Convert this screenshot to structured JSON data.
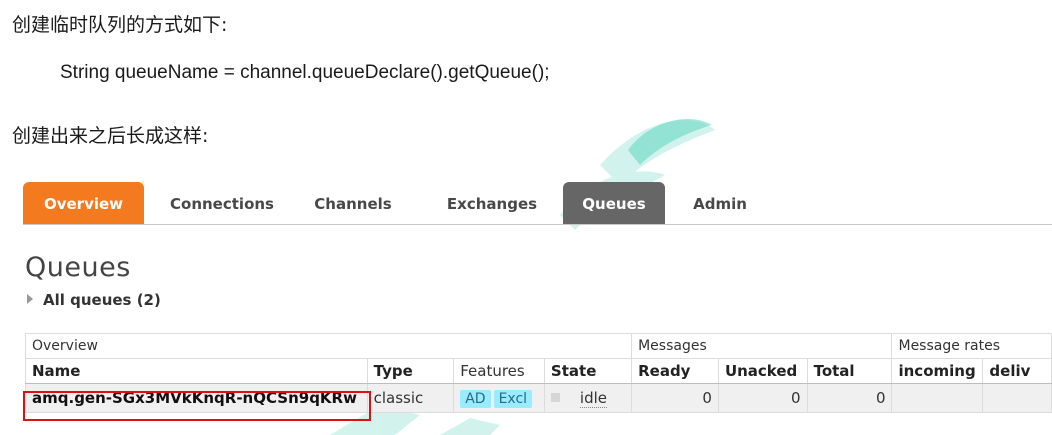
{
  "doc": {
    "line1": "创建临时队列的方式如下:",
    "code": "String queueName = channel.queueDeclare().getQueue();",
    "line2": "创建出来之后长成这样:"
  },
  "nav": {
    "tabs": [
      {
        "label": "Overview",
        "state": "active"
      },
      {
        "label": "Connections"
      },
      {
        "label": "Channels"
      },
      {
        "label": "Exchanges"
      },
      {
        "label": "Queues",
        "state": "selected"
      },
      {
        "label": "Admin"
      }
    ]
  },
  "page": {
    "title": "Queues",
    "all_queues": "All queues (2)"
  },
  "table": {
    "groups": [
      "Overview",
      "Messages",
      "Message rates"
    ],
    "headers": [
      "Name",
      "Type",
      "Features",
      "State",
      "Ready",
      "Unacked",
      "Total",
      "incoming",
      "deliv"
    ],
    "rows": [
      {
        "name": "amq.gen-SGx3MVkKnqR-nQCSn9qKRw",
        "type": "classic",
        "features": [
          "AD",
          "Excl"
        ],
        "state": "idle",
        "ready": "0",
        "unacked": "0",
        "total": "0",
        "incoming": "",
        "deliver": ""
      }
    ]
  },
  "colors": {
    "overview_tab": "#f47a20",
    "queues_tab": "#666666",
    "feature_pill": "#99ebff",
    "highlight_box": "#e01010"
  }
}
